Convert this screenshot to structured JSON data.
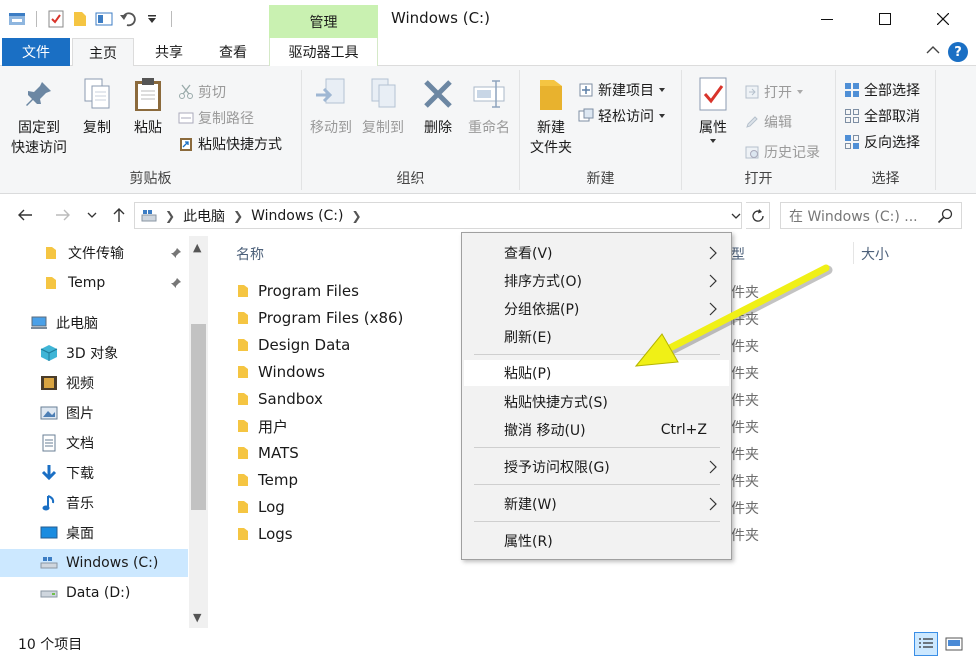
{
  "window": {
    "title": "Windows (C:)",
    "contextual_group": "管理",
    "controls": [
      "minimize",
      "maximize",
      "close"
    ]
  },
  "ribbon_tabs": {
    "file": "文件",
    "home": "主页",
    "share": "共享",
    "view": "查看",
    "drive_tools": "驱动器工具",
    "help": "?"
  },
  "ribbon": {
    "clipboard": {
      "label": "剪贴板",
      "pin_line1": "固定到",
      "pin_line2": "快速访问",
      "copy": "复制",
      "paste": "粘贴",
      "cut": "剪切",
      "copy_path": "复制路径",
      "paste_shortcut": "粘贴快捷方式"
    },
    "organize": {
      "label": "组织",
      "move_to": "移动到",
      "copy_to": "复制到",
      "delete": "删除",
      "rename": "重命名"
    },
    "new": {
      "label": "新建",
      "new_folder_line1": "新建",
      "new_folder_line2": "文件夹",
      "new_item": "新建项目",
      "easy_access": "轻松访问"
    },
    "open": {
      "label": "打开",
      "properties": "属性",
      "open": "打开",
      "edit": "编辑",
      "history": "历史记录"
    },
    "select": {
      "label": "选择",
      "select_all": "全部选择",
      "select_none": "全部取消",
      "invert": "反向选择"
    }
  },
  "address": {
    "crumbs": [
      "此电脑",
      "Windows (C:)"
    ],
    "search_placeholder": "在 Windows (C:) ..."
  },
  "nav": {
    "items": [
      {
        "label": "文件传输",
        "icon": "folder-icon",
        "pinned": true
      },
      {
        "label": "Temp",
        "icon": "folder-icon",
        "pinned": true
      },
      {
        "label": "此电脑",
        "icon": "computer-icon"
      },
      {
        "label": "3D 对象",
        "icon": "3d-objects-icon"
      },
      {
        "label": "视频",
        "icon": "video-icon"
      },
      {
        "label": "图片",
        "icon": "pictures-icon"
      },
      {
        "label": "文档",
        "icon": "documents-icon"
      },
      {
        "label": "下载",
        "icon": "download-icon"
      },
      {
        "label": "音乐",
        "icon": "music-icon"
      },
      {
        "label": "桌面",
        "icon": "desktop-icon"
      },
      {
        "label": "Windows (C:)",
        "icon": "drive-c-icon",
        "selected": true
      },
      {
        "label": "Data (D:)",
        "icon": "drive-d-icon"
      }
    ]
  },
  "columns": {
    "name": "名称",
    "type": "型",
    "size": "大小"
  },
  "files": [
    {
      "name": "Program Files",
      "type": "件夹"
    },
    {
      "name": "Program Files (x86)",
      "type": "件夹"
    },
    {
      "name": "Design Data",
      "type": "件夹"
    },
    {
      "name": "Windows",
      "type": "件夹"
    },
    {
      "name": "Sandbox",
      "type": "件夹"
    },
    {
      "name": "用户",
      "type": "件夹"
    },
    {
      "name": "MATS",
      "type": "件夹"
    },
    {
      "name": "Temp",
      "type": "件夹"
    },
    {
      "name": "Log",
      "type": "件夹"
    },
    {
      "name": "Logs",
      "type": "件夹"
    }
  ],
  "context_menu": {
    "view": "查看(V)",
    "sort": "排序方式(O)",
    "group": "分组依据(P)",
    "refresh": "刷新(E)",
    "paste": "粘贴(P)",
    "paste_shortcut": "粘贴快捷方式(S)",
    "undo": "撤消 移动(U)",
    "undo_accel": "Ctrl+Z",
    "grant_access": "授予访问权限(G)",
    "new": "新建(W)",
    "properties": "属性(R)"
  },
  "status": {
    "count": "10 个项目"
  },
  "colors": {
    "file_tab": "#1a6fc4",
    "contextual_tab": "#c9f1b1",
    "folder": "#f5c542",
    "selection": "#cce8ff",
    "annotation_arrow": "#f0f016"
  }
}
